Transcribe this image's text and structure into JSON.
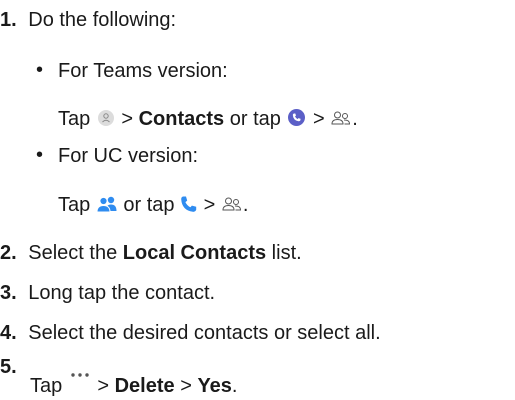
{
  "steps": [
    {
      "number": "1.",
      "text": "Do the following:"
    },
    {
      "number": "2.",
      "pre": "Select the ",
      "bold": "Local Contacts",
      "post": " list."
    },
    {
      "number": "3.",
      "text": "Long tap the contact."
    },
    {
      "number": "4.",
      "text": "Select the desired contacts or select all."
    },
    {
      "number": "5.",
      "pre": "Tap ",
      "mid1": " > ",
      "bold1": "Delete",
      "mid2": " > ",
      "bold2": "Yes",
      "post": "."
    }
  ],
  "sub": {
    "teams_label": "For Teams version:",
    "teams_instr": {
      "tap": "Tap ",
      "gt1": " > ",
      "bold": "Contacts",
      "or": " or tap ",
      "gt2": " > ",
      "end": "."
    },
    "uc_label": "For UC version:",
    "uc_instr": {
      "tap": "Tap ",
      "or": " or tap ",
      "gt": " > ",
      "end": "."
    },
    "bullet": "•"
  },
  "icons": {
    "teams_avatar": "person-circle-icon",
    "teams_calls": "phone-circle-icon",
    "contacts": "contacts-icon",
    "uc_people": "people-icon",
    "uc_phone": "phone-icon",
    "more": "more-icon"
  },
  "colors": {
    "text": "#1a1a1a",
    "teams_purple": "#5b5fc7",
    "uc_blue": "#2f8cf0",
    "icon_grey": "#8a8a8a"
  }
}
